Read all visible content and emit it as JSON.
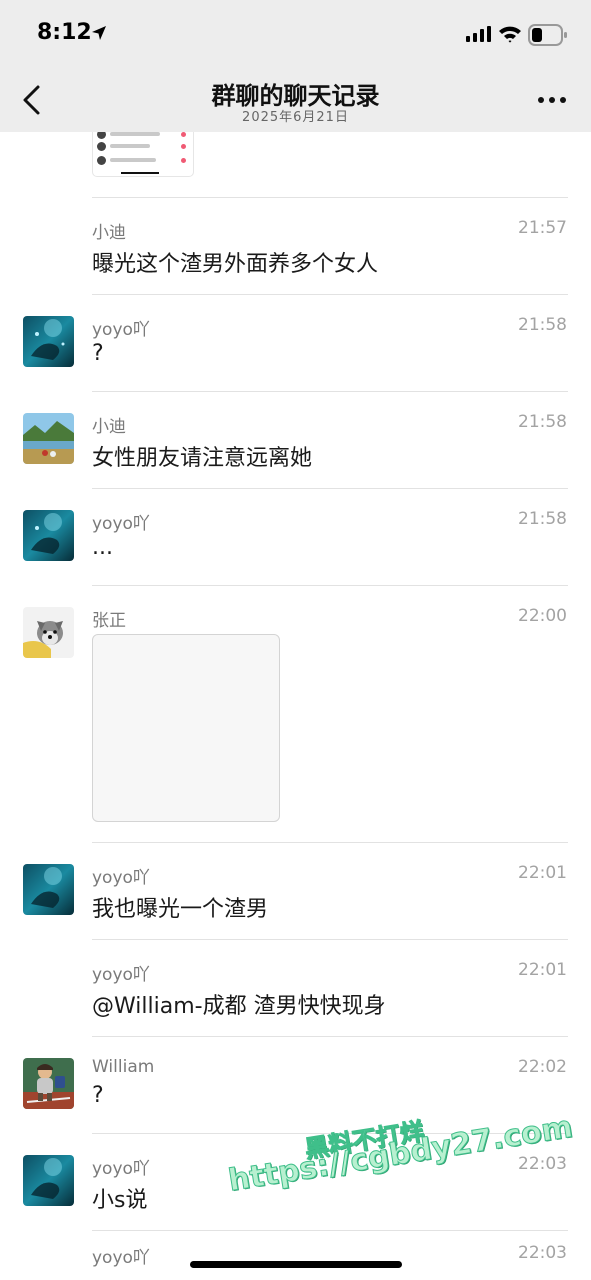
{
  "status": {
    "time": "8:12"
  },
  "header": {
    "title": "群聊的聊天记录",
    "subtitle": "2025年6月21日"
  },
  "messages": [
    {
      "sender": "小迪",
      "time": "21:57",
      "text": "曝光这个渣男外面养多个女人"
    },
    {
      "sender": "yoyo吖",
      "time": "21:58",
      "text": "?"
    },
    {
      "sender": "小迪",
      "time": "21:58",
      "text": "女性朋友请注意远离她"
    },
    {
      "sender": "yoyo吖",
      "time": "21:58",
      "text": "..."
    },
    {
      "sender": "张正",
      "time": "22:00",
      "text": ""
    },
    {
      "sender": "yoyo吖",
      "time": "22:01",
      "text": "我也曝光一个渣男"
    },
    {
      "sender": "yoyo吖",
      "time": "22:01",
      "text": "@William-成都 渣男快快现身"
    },
    {
      "sender": "William",
      "time": "22:02",
      "text": "?"
    },
    {
      "sender": "yoyo吖",
      "time": "22:03",
      "text": "小s说"
    },
    {
      "sender": "yoyo吖",
      "time": "22:03",
      "text": ""
    }
  ],
  "watermark": {
    "line1": "黑料不打烊",
    "line2": "https://cgbdy27.com"
  },
  "icons": {
    "back": "chevron-left-icon",
    "more": "more-dots-icon",
    "location": "location-arrow-icon",
    "signal": "signal-icon",
    "wifi": "wifi-icon",
    "battery": "battery-icon"
  },
  "colors": {
    "header_bg": "#ededed",
    "name": "#7a7a7a",
    "time": "#a3a3a3",
    "watermark": "#3fbf8a"
  }
}
